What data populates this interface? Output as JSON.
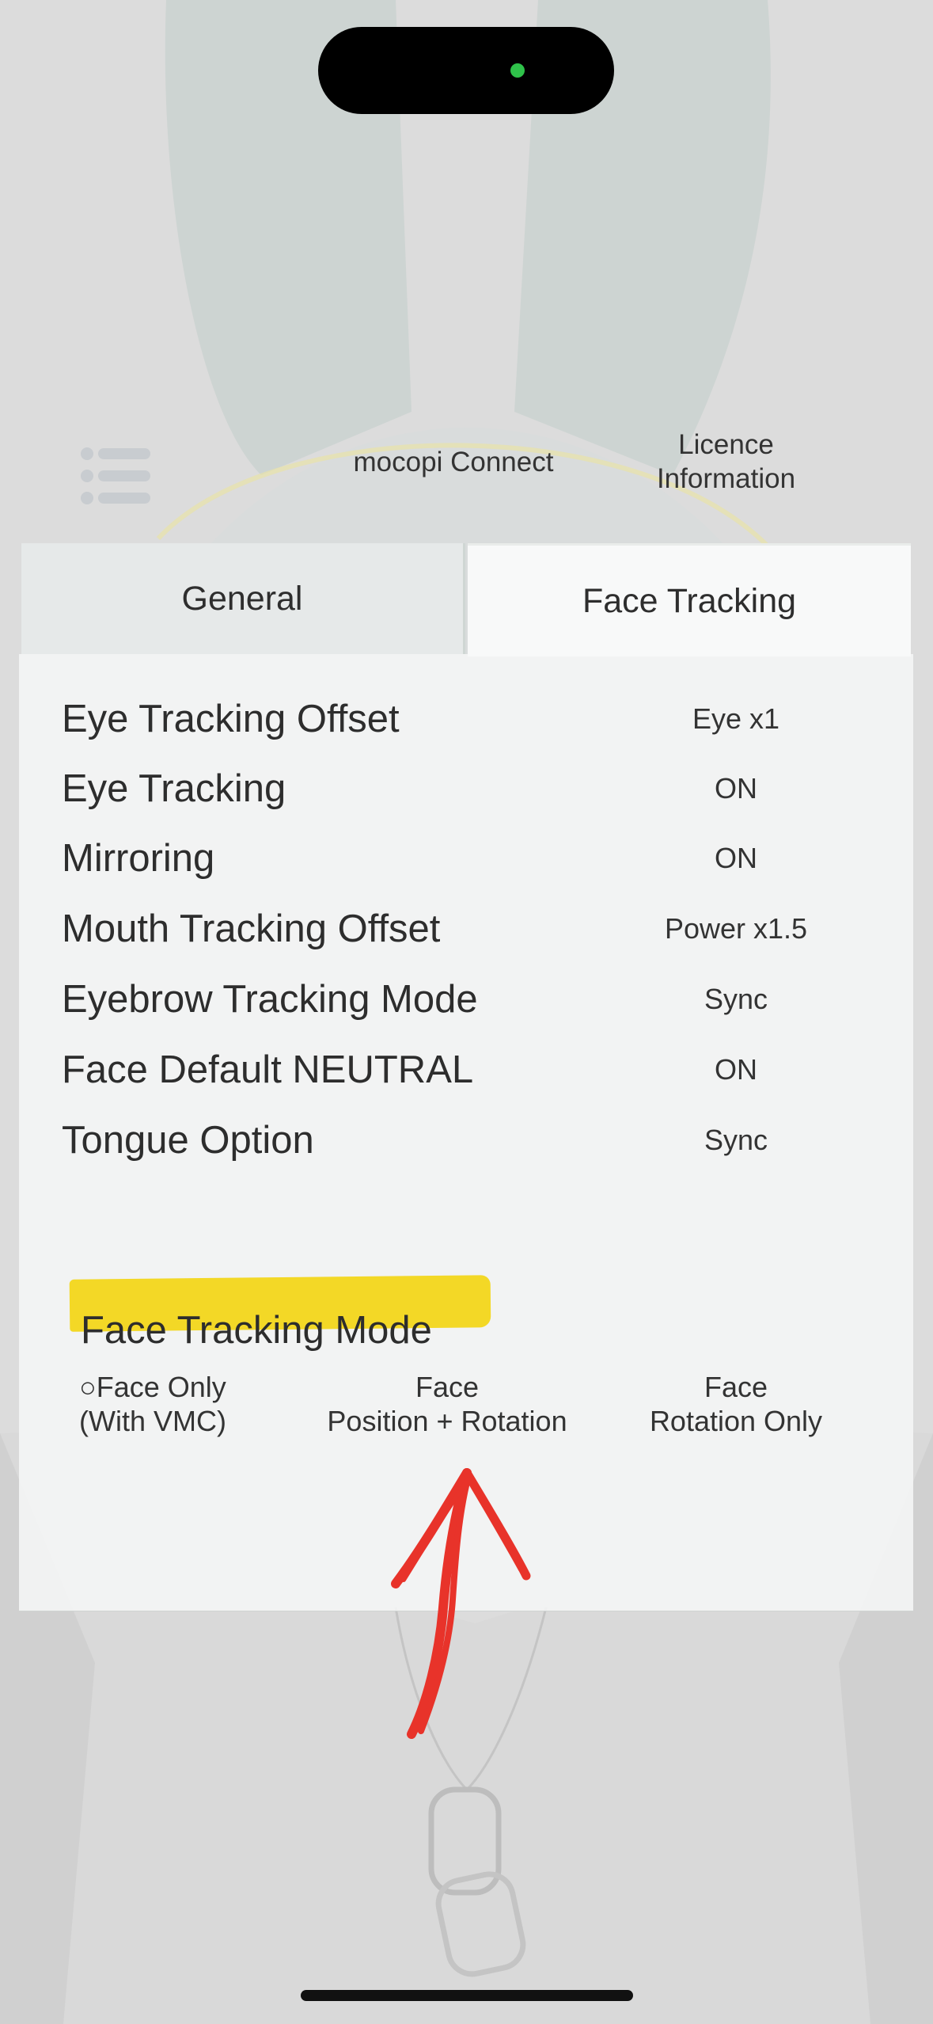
{
  "header": {
    "connect_label": "mocopi Connect",
    "licence_line1": "Licence",
    "licence_line2": "Information"
  },
  "tabs": [
    {
      "label": "General",
      "selected": false
    },
    {
      "label": "Face Tracking",
      "selected": true
    }
  ],
  "settings": [
    {
      "label": "Eye Tracking Offset",
      "value": "Eye x1"
    },
    {
      "label": "Eye Tracking",
      "value": "ON"
    },
    {
      "label": "Mirroring",
      "value": "ON"
    },
    {
      "label": "Mouth Tracking Offset",
      "value": "Power x1.5"
    },
    {
      "label": "Eyebrow Tracking Mode",
      "value": "Sync"
    },
    {
      "label": "Face Default NEUTRAL",
      "value": "ON"
    },
    {
      "label": "Tongue Option",
      "value": "Sync"
    }
  ],
  "face_tracking_mode": {
    "title": "Face Tracking Mode",
    "options": [
      {
        "line1": "○Face Only",
        "line2": "(With VMC)"
      },
      {
        "line1": "Face",
        "line2": "Position + Rotation"
      },
      {
        "line1": "Face",
        "line2": "Rotation Only"
      }
    ]
  },
  "colors": {
    "highlight": "#f2d61a",
    "annotation_arrow": "#e8332a",
    "status_dot": "#2fc24a"
  },
  "icons": {
    "menu": "list-menu-icon",
    "arrow": "hand-drawn-up-arrow"
  }
}
